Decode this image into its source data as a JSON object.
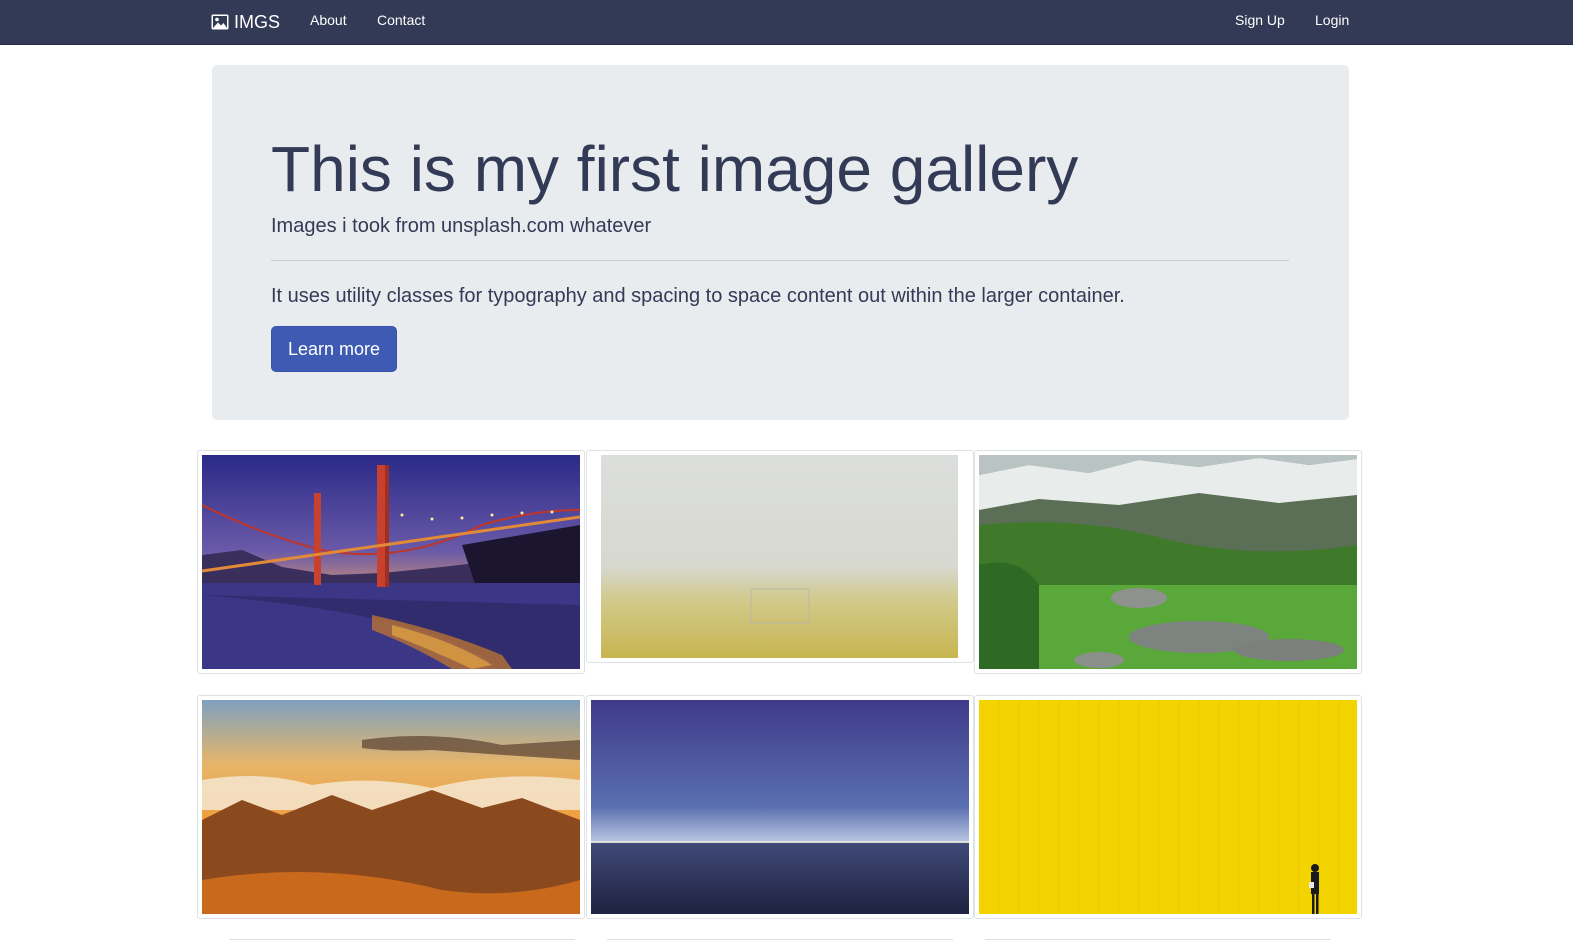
{
  "navbar": {
    "brand": "IMGS",
    "brand_icon": "image-icon",
    "links_left": [
      "About",
      "Contact"
    ],
    "links_right": [
      "Sign Up",
      "Login"
    ]
  },
  "jumbotron": {
    "title": "This is my first image gallery",
    "lead": "Images i took from unsplash.com whatever",
    "text": "It uses utility classes for typography and spacing to space content out within the larger container.",
    "button": "Learn more"
  },
  "colors": {
    "nav_bg": "#323a56",
    "jumbotron_bg": "#e9ecef",
    "button_bg": "#3f5ab3",
    "text": "#323a56"
  },
  "gallery": {
    "images": [
      "golden-gate-bridge-at-dusk",
      "foggy-field-with-goal",
      "green-mountain-valley",
      "sunset-over-mountain-clouds",
      "ocean-horizon-at-dusk",
      "yellow-wall-with-person"
    ]
  }
}
